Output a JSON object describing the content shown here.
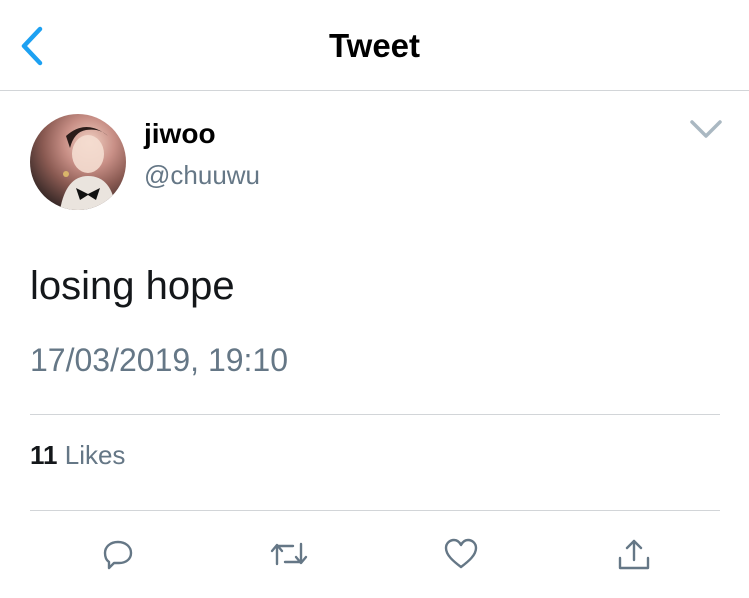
{
  "nav": {
    "title": "Tweet",
    "back_icon": "chevron-left-icon"
  },
  "tweet": {
    "author_name": "jiwoo",
    "author_handle": "@chuuwu",
    "text": "losing hope",
    "timestamp": "17/03/2019, 19:10",
    "likes_count": "11",
    "likes_label": "Likes"
  },
  "actions": [
    "reply-icon",
    "retweet-icon",
    "like-icon",
    "share-icon"
  ],
  "colors": {
    "accent": "#1da1f2",
    "secondary_text": "#657786",
    "divider": "#d2d5d8"
  }
}
